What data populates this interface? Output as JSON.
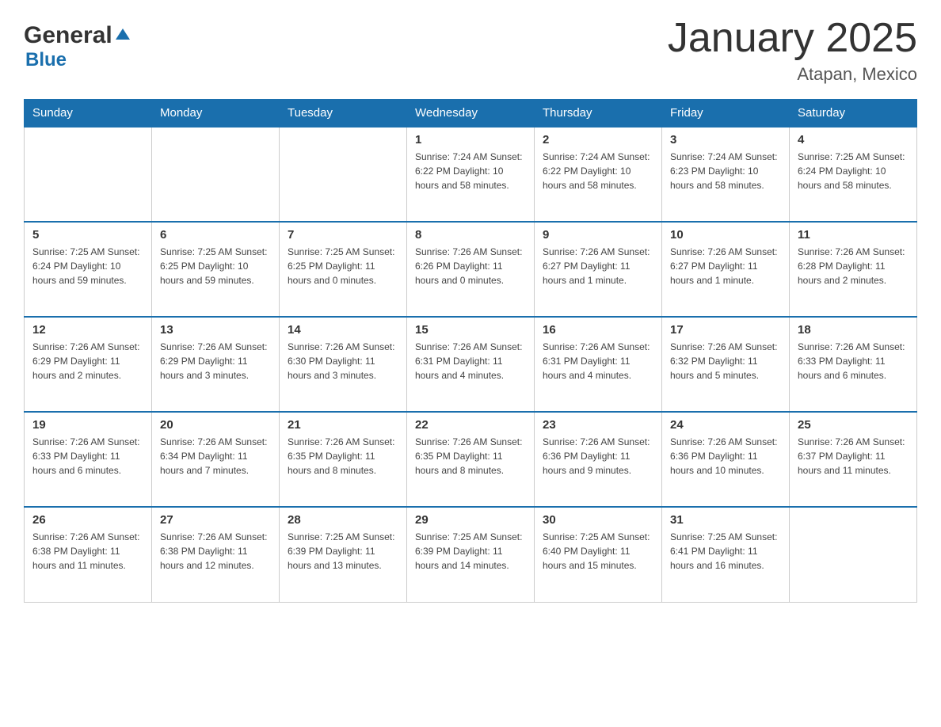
{
  "header": {
    "logo_general": "General",
    "logo_blue": "Blue",
    "title": "January 2025",
    "subtitle": "Atapan, Mexico"
  },
  "days_of_week": [
    "Sunday",
    "Monday",
    "Tuesday",
    "Wednesday",
    "Thursday",
    "Friday",
    "Saturday"
  ],
  "weeks": [
    [
      {
        "day": "",
        "info": ""
      },
      {
        "day": "",
        "info": ""
      },
      {
        "day": "",
        "info": ""
      },
      {
        "day": "1",
        "info": "Sunrise: 7:24 AM\nSunset: 6:22 PM\nDaylight: 10 hours\nand 58 minutes."
      },
      {
        "day": "2",
        "info": "Sunrise: 7:24 AM\nSunset: 6:22 PM\nDaylight: 10 hours\nand 58 minutes."
      },
      {
        "day": "3",
        "info": "Sunrise: 7:24 AM\nSunset: 6:23 PM\nDaylight: 10 hours\nand 58 minutes."
      },
      {
        "day": "4",
        "info": "Sunrise: 7:25 AM\nSunset: 6:24 PM\nDaylight: 10 hours\nand 58 minutes."
      }
    ],
    [
      {
        "day": "5",
        "info": "Sunrise: 7:25 AM\nSunset: 6:24 PM\nDaylight: 10 hours\nand 59 minutes."
      },
      {
        "day": "6",
        "info": "Sunrise: 7:25 AM\nSunset: 6:25 PM\nDaylight: 10 hours\nand 59 minutes."
      },
      {
        "day": "7",
        "info": "Sunrise: 7:25 AM\nSunset: 6:25 PM\nDaylight: 11 hours\nand 0 minutes."
      },
      {
        "day": "8",
        "info": "Sunrise: 7:26 AM\nSunset: 6:26 PM\nDaylight: 11 hours\nand 0 minutes."
      },
      {
        "day": "9",
        "info": "Sunrise: 7:26 AM\nSunset: 6:27 PM\nDaylight: 11 hours\nand 1 minute."
      },
      {
        "day": "10",
        "info": "Sunrise: 7:26 AM\nSunset: 6:27 PM\nDaylight: 11 hours\nand 1 minute."
      },
      {
        "day": "11",
        "info": "Sunrise: 7:26 AM\nSunset: 6:28 PM\nDaylight: 11 hours\nand 2 minutes."
      }
    ],
    [
      {
        "day": "12",
        "info": "Sunrise: 7:26 AM\nSunset: 6:29 PM\nDaylight: 11 hours\nand 2 minutes."
      },
      {
        "day": "13",
        "info": "Sunrise: 7:26 AM\nSunset: 6:29 PM\nDaylight: 11 hours\nand 3 minutes."
      },
      {
        "day": "14",
        "info": "Sunrise: 7:26 AM\nSunset: 6:30 PM\nDaylight: 11 hours\nand 3 minutes."
      },
      {
        "day": "15",
        "info": "Sunrise: 7:26 AM\nSunset: 6:31 PM\nDaylight: 11 hours\nand 4 minutes."
      },
      {
        "day": "16",
        "info": "Sunrise: 7:26 AM\nSunset: 6:31 PM\nDaylight: 11 hours\nand 4 minutes."
      },
      {
        "day": "17",
        "info": "Sunrise: 7:26 AM\nSunset: 6:32 PM\nDaylight: 11 hours\nand 5 minutes."
      },
      {
        "day": "18",
        "info": "Sunrise: 7:26 AM\nSunset: 6:33 PM\nDaylight: 11 hours\nand 6 minutes."
      }
    ],
    [
      {
        "day": "19",
        "info": "Sunrise: 7:26 AM\nSunset: 6:33 PM\nDaylight: 11 hours\nand 6 minutes."
      },
      {
        "day": "20",
        "info": "Sunrise: 7:26 AM\nSunset: 6:34 PM\nDaylight: 11 hours\nand 7 minutes."
      },
      {
        "day": "21",
        "info": "Sunrise: 7:26 AM\nSunset: 6:35 PM\nDaylight: 11 hours\nand 8 minutes."
      },
      {
        "day": "22",
        "info": "Sunrise: 7:26 AM\nSunset: 6:35 PM\nDaylight: 11 hours\nand 8 minutes."
      },
      {
        "day": "23",
        "info": "Sunrise: 7:26 AM\nSunset: 6:36 PM\nDaylight: 11 hours\nand 9 minutes."
      },
      {
        "day": "24",
        "info": "Sunrise: 7:26 AM\nSunset: 6:36 PM\nDaylight: 11 hours\nand 10 minutes."
      },
      {
        "day": "25",
        "info": "Sunrise: 7:26 AM\nSunset: 6:37 PM\nDaylight: 11 hours\nand 11 minutes."
      }
    ],
    [
      {
        "day": "26",
        "info": "Sunrise: 7:26 AM\nSunset: 6:38 PM\nDaylight: 11 hours\nand 11 minutes."
      },
      {
        "day": "27",
        "info": "Sunrise: 7:26 AM\nSunset: 6:38 PM\nDaylight: 11 hours\nand 12 minutes."
      },
      {
        "day": "28",
        "info": "Sunrise: 7:25 AM\nSunset: 6:39 PM\nDaylight: 11 hours\nand 13 minutes."
      },
      {
        "day": "29",
        "info": "Sunrise: 7:25 AM\nSunset: 6:39 PM\nDaylight: 11 hours\nand 14 minutes."
      },
      {
        "day": "30",
        "info": "Sunrise: 7:25 AM\nSunset: 6:40 PM\nDaylight: 11 hours\nand 15 minutes."
      },
      {
        "day": "31",
        "info": "Sunrise: 7:25 AM\nSunset: 6:41 PM\nDaylight: 11 hours\nand 16 minutes."
      },
      {
        "day": "",
        "info": ""
      }
    ]
  ]
}
